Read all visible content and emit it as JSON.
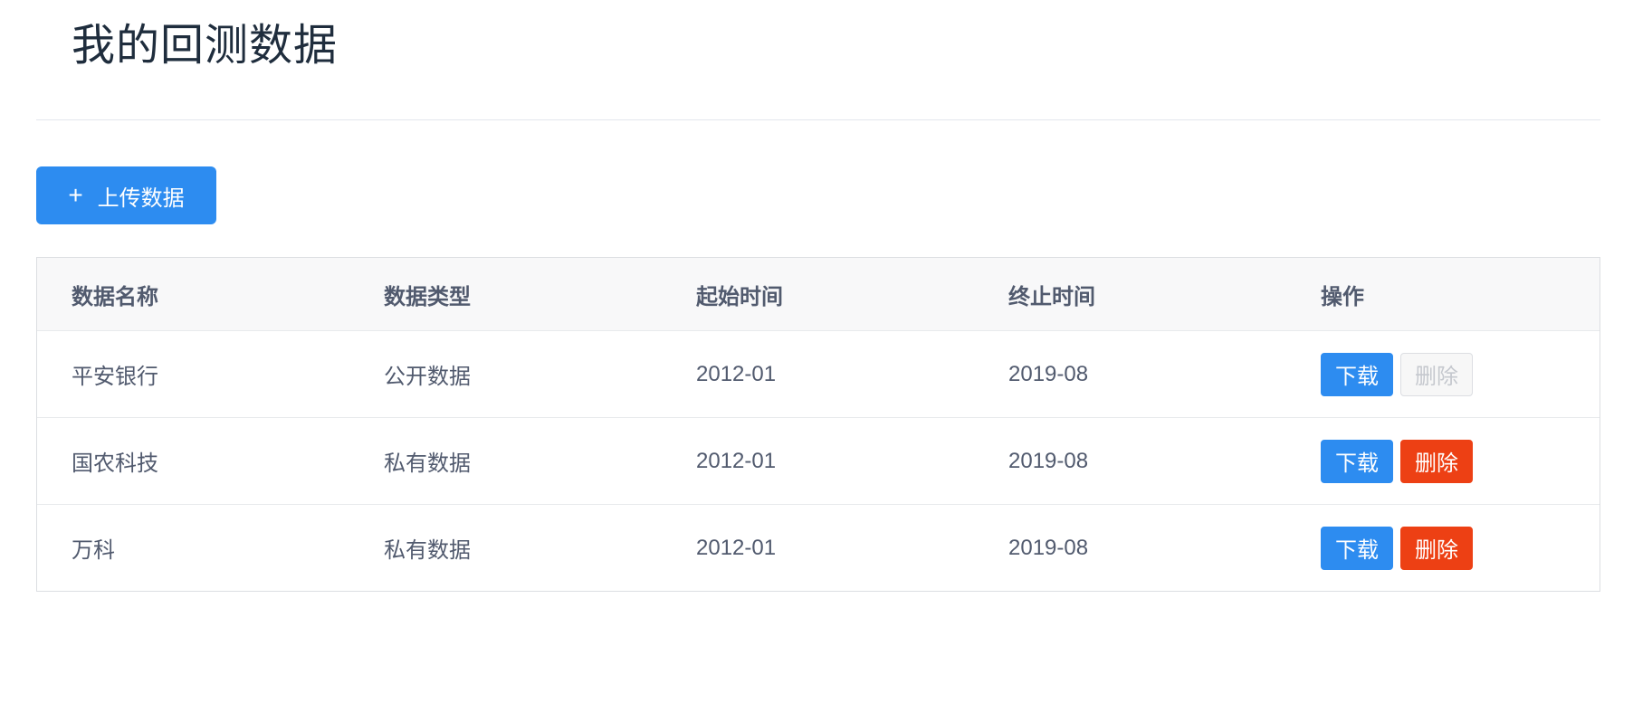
{
  "page": {
    "title": "我的回测数据"
  },
  "toolbar": {
    "upload_label": "上传数据"
  },
  "table": {
    "headers": [
      "数据名称",
      "数据类型",
      "起始时间",
      "终止时间",
      "操作"
    ],
    "rows": [
      {
        "name": "平安银行",
        "type": "公开数据",
        "start": "2012-01",
        "end": "2019-08",
        "download": "下载",
        "delete": "删除",
        "delete_disabled": true
      },
      {
        "name": "国农科技",
        "type": "私有数据",
        "start": "2012-01",
        "end": "2019-08",
        "download": "下载",
        "delete": "删除",
        "delete_disabled": false
      },
      {
        "name": "万科",
        "type": "私有数据",
        "start": "2012-01",
        "end": "2019-08",
        "download": "下载",
        "delete": "删除",
        "delete_disabled": false
      }
    ]
  },
  "colors": {
    "primary": "#2d8cf0",
    "danger": "#ed4014",
    "disabled_text": "#c5c8ce"
  }
}
